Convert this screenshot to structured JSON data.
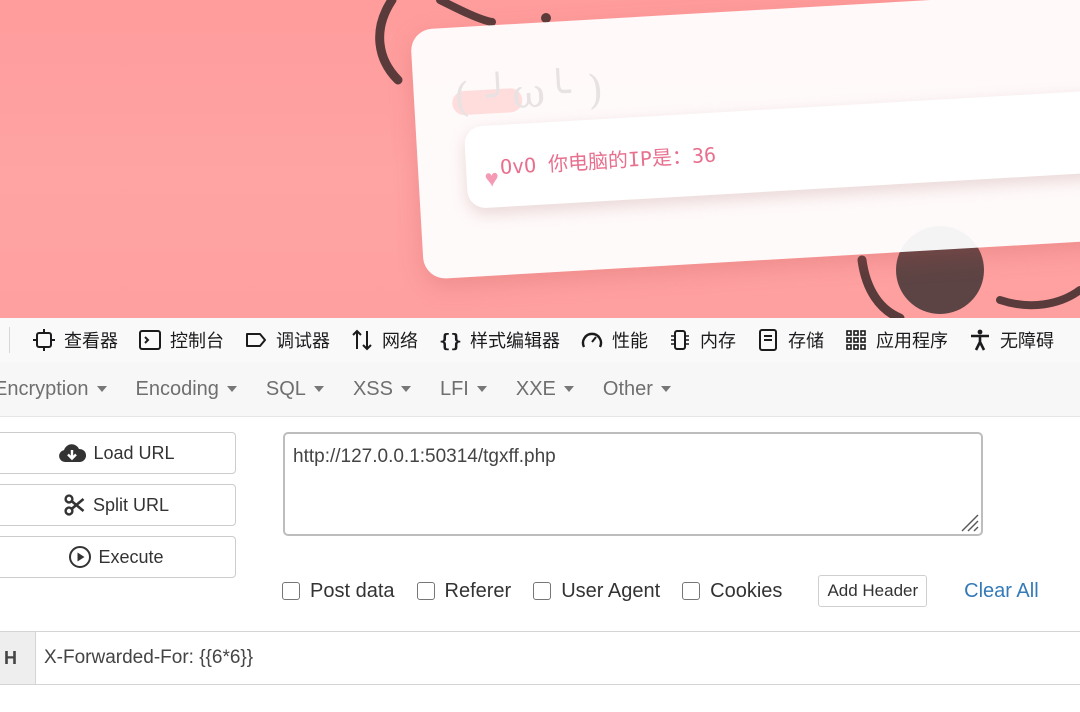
{
  "webpage": {
    "ip_heart": "♥",
    "ip_text": "OvO 你电脑的IP是：36"
  },
  "devtools": {
    "tabs": [
      {
        "icon": "inspector-icon",
        "label": "查看器"
      },
      {
        "icon": "console-icon",
        "label": "控制台"
      },
      {
        "icon": "debugger-icon",
        "label": "调试器"
      },
      {
        "icon": "network-icon",
        "label": "网络"
      },
      {
        "icon": "style-editor-icon",
        "label": "样式编辑器"
      },
      {
        "icon": "performance-icon",
        "label": "性能"
      },
      {
        "icon": "memory-icon",
        "label": "内存"
      },
      {
        "icon": "storage-icon",
        "label": "存储"
      },
      {
        "icon": "application-icon",
        "label": "应用程序"
      },
      {
        "icon": "accessibility-icon",
        "label": "无障碍"
      }
    ]
  },
  "hackbar": {
    "menu": [
      "Encryption",
      "Encoding",
      "SQL",
      "XSS",
      "LFI",
      "XXE",
      "Other"
    ],
    "buttons": {
      "load_url": "Load URL",
      "split_url": "Split URL",
      "execute": "Execute"
    },
    "url": "http://127.0.0.1:50314/tgxff.php",
    "options": {
      "post_data": "Post data",
      "referer": "Referer",
      "user_agent": "User Agent",
      "cookies": "Cookies"
    },
    "add_header": "Add Header",
    "clear_all": "Clear All",
    "header_row": {
      "tag": "H",
      "value": "X-Forwarded-For: {{6*6}}"
    }
  },
  "colors": {
    "page_background": "#ffa0a0",
    "ip_text": "#e8708f",
    "link": "#337ab7"
  }
}
